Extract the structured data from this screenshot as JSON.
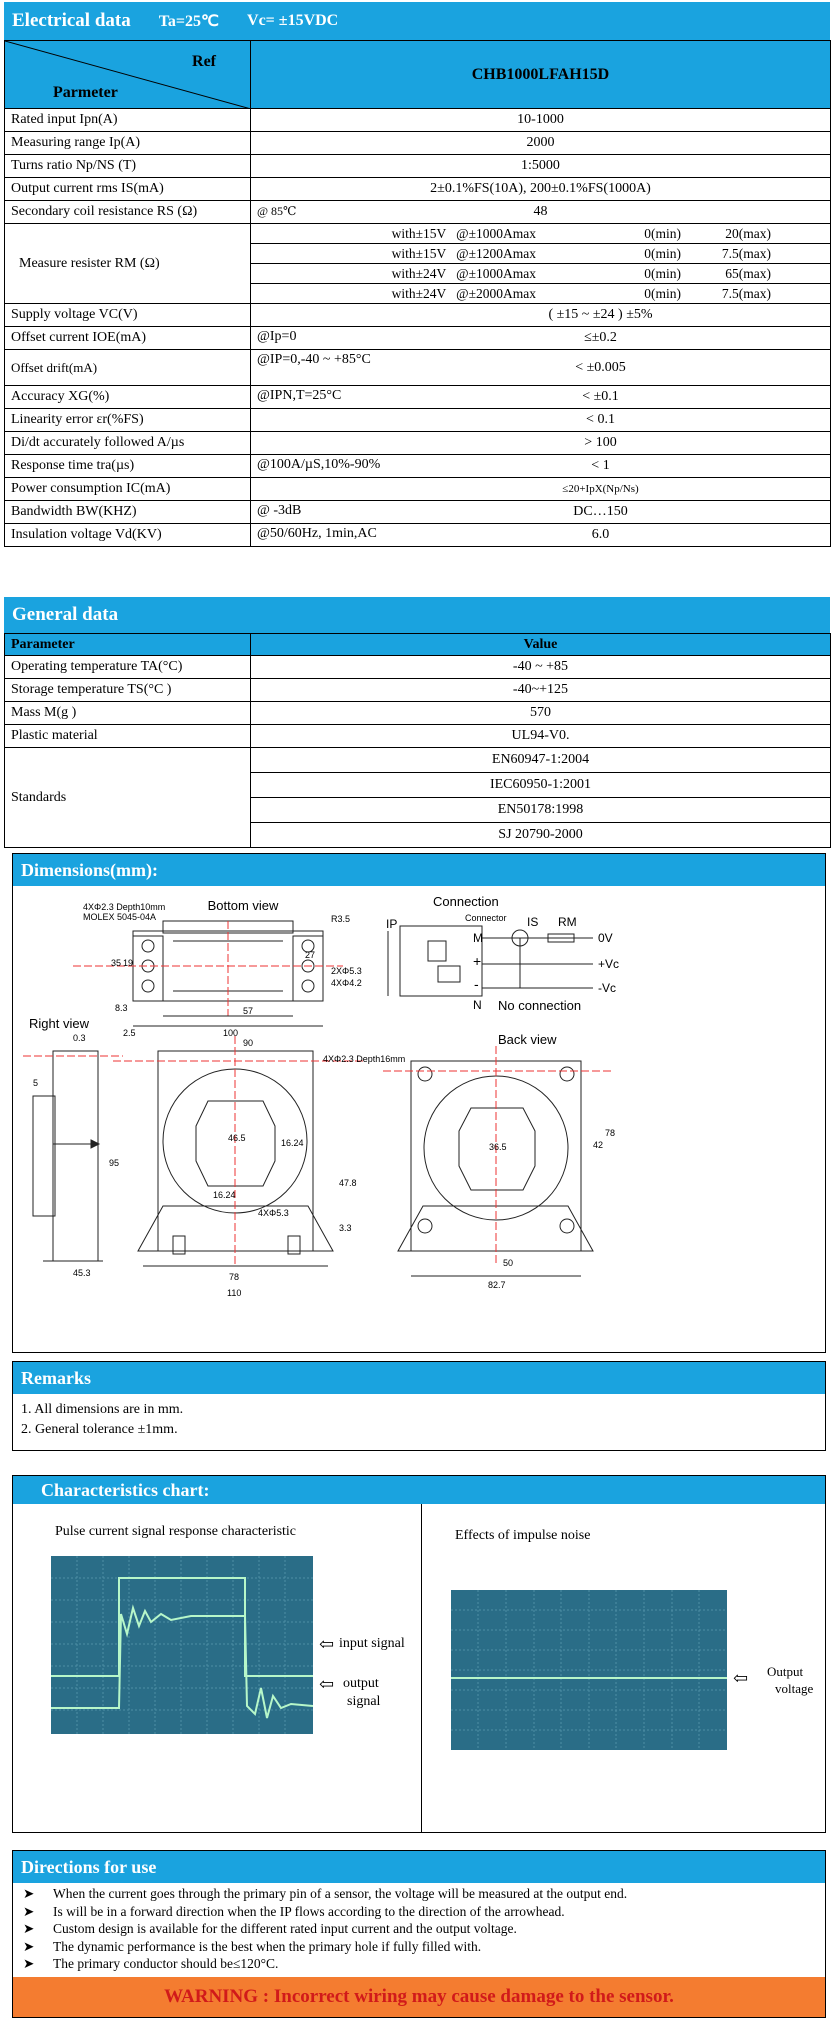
{
  "electrical": {
    "title": "Electrical data",
    "cond1": "Ta=25℃",
    "cond2": "Vc= ±15VDC",
    "head_ref": "Ref",
    "head_param": "Parmeter",
    "head_model": "CHB1000LFAH15D",
    "rows": [
      {
        "p": "Rated input    Ipn(A)",
        "v": "10-1000"
      },
      {
        "p": "Measuring range    Ip(A)",
        "v": "2000"
      },
      {
        "p": "Turns ratio Np/NS (T)",
        "v": "1:5000"
      },
      {
        "p": "Output current rms IS(mA)",
        "v": "2±0.1%FS(10A), 200±0.1%FS(1000A)"
      },
      {
        "p": "Secondary coil resistance RS (Ω)",
        "cond": "@ 85℃",
        "v": "48"
      }
    ],
    "rm_label": "Measure resister RM (Ω)",
    "rm_rows": [
      {
        "a": "with±15V   @±1000Amax",
        "min": "0(min)",
        "max": "20(max)"
      },
      {
        "a": "with±15V   @±1200Amax",
        "min": "0(min)",
        "max": "7.5(max)"
      },
      {
        "a": "with±24V   @±1000Amax",
        "min": "0(min)",
        "max": "65(max)"
      },
      {
        "a": "with±24V   @±2000Amax",
        "min": "0(min)",
        "max": "7.5(max)"
      }
    ],
    "rows2": [
      {
        "p": "Supply voltage    VC(V)",
        "cond": "",
        "v": "( ±15 ~ ±24 )   ±5%"
      },
      {
        "p": "Offset current    IOE(mA)",
        "cond": "@Ip=0",
        "v": "≤±0.2"
      },
      {
        "p": "Offset drift(mA)",
        "cond": "@IP=0,-40 ~ +85°C",
        "v": "< ±0.005"
      },
      {
        "p": "Accuracy    XG(%)",
        "cond": "@IPN,T=25°C",
        "v": "< ±0.1"
      },
      {
        "p": "Linearity error    εr(%FS)",
        "cond": "",
        "v": "< 0.1"
      },
      {
        "p": "Di/dt accurately followed    A/µs",
        "cond": "",
        "v": "> 100"
      },
      {
        "p": "Response time    tra(µs)",
        "cond": "@100A/µS,10%-90%",
        "v": "< 1"
      },
      {
        "p": "Power consumption    IC(mA)",
        "cond": "",
        "v": "≤20+IpX(Np/Ns)"
      },
      {
        "p": "Bandwidth    BW(KHZ)",
        "cond": "@ -3dB",
        "v": "DC…150"
      },
      {
        "p": "Insulation voltage    Vd(KV)",
        "cond": "@50/60Hz, 1min,AC",
        "v": "6.0"
      }
    ]
  },
  "general": {
    "title": "General data",
    "head_param": "Parameter",
    "head_value": "Value",
    "rows": [
      {
        "p": "Operating temperature    TA(°C)",
        "v": "-40 ~ +85"
      },
      {
        "p": "Storage temperature    TS(°C )",
        "v": "-40~+125"
      },
      {
        "p": "Mass    M(g )",
        "v": "570"
      },
      {
        "p": "Plastic material",
        "v": "UL94-V0."
      }
    ],
    "standards_label": "Standards",
    "standards": [
      "EN60947-1:2004",
      "IEC60950-1:2001",
      "EN50178:1998",
      "SJ 20790-2000"
    ]
  },
  "dimensions": {
    "title": "Dimensions(mm):",
    "bottom_view": "Bottom view",
    "connection": "Connection",
    "connector": "Connector",
    "right_view": "Right view",
    "back_view": "Back view",
    "no_connection": "No connection",
    "labels": {
      "molex1": "4XΦ2.3  Depth10mm",
      "molex2": "MOLEX  5045-04A",
      "r35": "R3.5",
      "d27": "27",
      "d2x53": "2XΦ5.3",
      "d4x42": "4XΦ4.2",
      "d57": "57",
      "d100": "100",
      "d35": "35",
      "d19": "19",
      "d83": "8.3",
      "d03": "0.3",
      "d25": "2.5",
      "d5": "5",
      "d95": "95",
      "d453": "45.3",
      "d90": "90",
      "d465": "46.5",
      "d1624": "16.24",
      "d1624b": "16.24",
      "d4x53": "4XΦ5.3",
      "d478": "47.8",
      "d33": "3.3",
      "d78": "78",
      "d110": "110",
      "d4x23b": "4XΦ2.3  Depth16mm",
      "d365": "36.5",
      "d42": "42",
      "d78b": "78",
      "d50": "50",
      "d827": "82.7",
      "ip": "IP",
      "is": "IS",
      "rm": "RM",
      "m": "M",
      "plus": "+",
      "minus": "-",
      "n": "N",
      "v0": "0V",
      "vcp": "+Vc",
      "vcm": "-Vc"
    }
  },
  "remarks": {
    "title": "Remarks",
    "items": [
      "1. All dimensions are in mm.",
      "2. General tolerance ±1mm."
    ]
  },
  "characteristics": {
    "title": "Characteristics chart:",
    "left_caption": "Pulse current signal response characteristic",
    "right_caption": "Effects of impulse noise",
    "input_signal": "input signal",
    "output_signal_1": "output",
    "output_signal_2": "signal",
    "output_voltage_1": "Output",
    "output_voltage_2": "voltage"
  },
  "directions": {
    "title": "Directions for use",
    "items": [
      "When the current goes through the primary pin of a sensor, the voltage will be measured at the output end.",
      "Is will be in a forward direction when the IP flows according to the direction of the arrowhead.",
      "Custom design is available for the different rated input current and the output voltage.",
      "The dynamic performance is the best when the primary hole if fully filled with.",
      "The primary conductor should be≤120°C."
    ],
    "warning": "WARNING : Incorrect wiring may cause damage to the sensor."
  },
  "colors": {
    "accent": "#1aa3df",
    "warning_bg": "#f47c30",
    "warning_text": "#d11a1a",
    "scope_bg": "#2a6d87",
    "trace": "#b7f7c9"
  }
}
